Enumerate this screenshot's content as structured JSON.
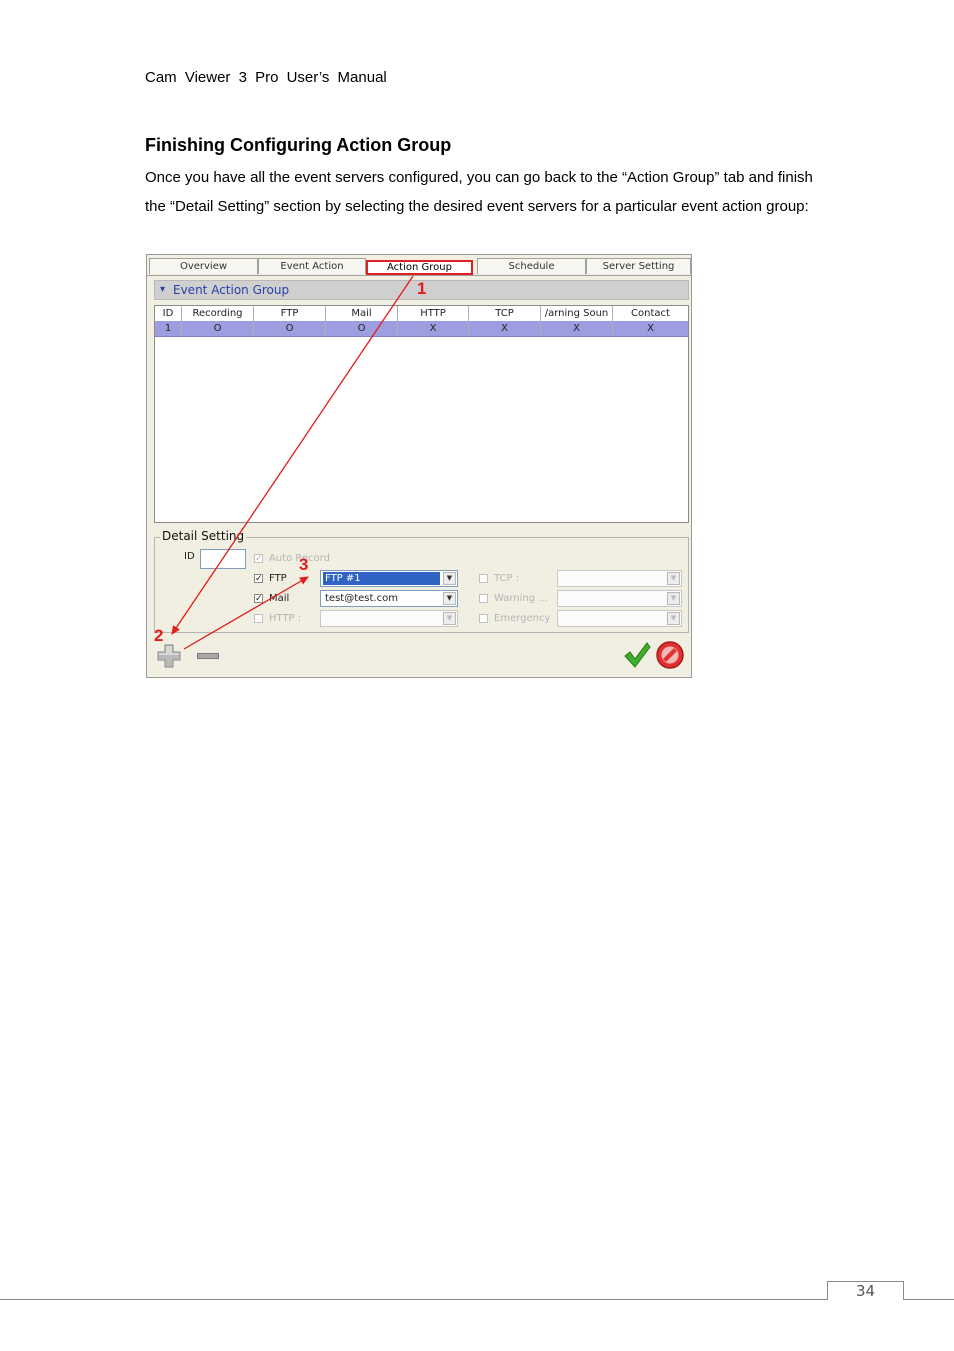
{
  "doc": {
    "header": "Cam Viewer 3 Pro User’s Manual",
    "section_title": "Finishing Configuring Action Group",
    "paragraph": "Once you have all the event servers configured, you can go back to the “Action Group” tab and finish the “Detail Setting” section by selecting the desired event servers for a particular event action group:",
    "page_number": "34"
  },
  "tabs": [
    {
      "label": "Overview"
    },
    {
      "label": "Event Action"
    },
    {
      "label": "Action Group"
    },
    {
      "label": "Schedule"
    },
    {
      "label": "Server Setting"
    }
  ],
  "group": {
    "title": "Event Action Group"
  },
  "grid": {
    "columns": [
      "ID",
      "Recording",
      "FTP",
      "Mail",
      "HTTP",
      "TCP",
      "/arning Soun",
      "Contact"
    ],
    "rows": [
      [
        "1",
        "O",
        "O",
        "O",
        "X",
        "X",
        "X",
        "X"
      ]
    ]
  },
  "detail": {
    "legend": "Detail Setting",
    "id_label": "ID",
    "id_value": "",
    "auto_record": "Auto Record",
    "ftp_label": "FTP",
    "ftp_value": "FTP #1",
    "mail_label": "Mail",
    "mail_value": "test@test.com",
    "http_label": "HTTP :",
    "tcp_label": "TCP :",
    "warning_label": "Warning ...",
    "emergency_label": "Emergency"
  },
  "callouts": [
    "1",
    "2",
    "3"
  ],
  "colors": {
    "highlight": "#e31b1b",
    "selected_row": "#9c9ee0",
    "combo_selected": "#3163c4"
  },
  "icons": {
    "add": "plus-icon",
    "remove": "minus-icon",
    "ok": "checkmark-icon",
    "cancel": "no-entry-icon",
    "dropdown": "chevron-down-icon"
  }
}
